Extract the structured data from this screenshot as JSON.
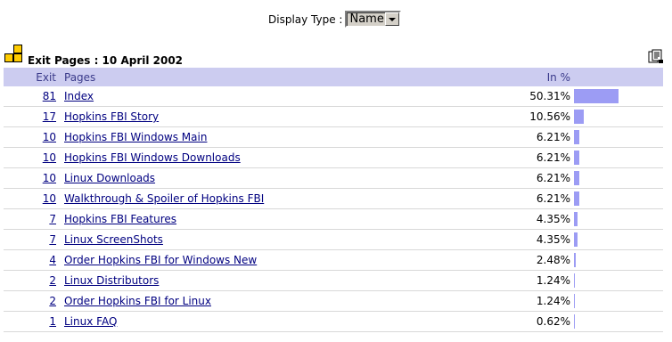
{
  "display_type": {
    "label": "Display Type :",
    "selected": "Name"
  },
  "section": {
    "title": "Exit Pages : 10 April 2002"
  },
  "table": {
    "headers": {
      "exit": "Exit",
      "pages": "Pages",
      "pct": "In %"
    },
    "rows": [
      {
        "exit": "81",
        "page": "Index",
        "pct": "50.31%",
        "share": 0.5031
      },
      {
        "exit": "17",
        "page": "Hopkins FBI Story",
        "pct": "10.56%",
        "share": 0.1056
      },
      {
        "exit": "10",
        "page": "Hopkins FBI Windows Main",
        "pct": "6.21%",
        "share": 0.0621
      },
      {
        "exit": "10",
        "page": "Hopkins FBI Windows Downloads",
        "pct": "6.21%",
        "share": 0.0621
      },
      {
        "exit": "10",
        "page": "Linux Downloads",
        "pct": "6.21%",
        "share": 0.0621
      },
      {
        "exit": "10",
        "page": "Walkthrough & Spoiler of Hopkins FBI",
        "pct": "6.21%",
        "share": 0.0621
      },
      {
        "exit": "7",
        "page": "Hopkins FBI Features",
        "pct": "4.35%",
        "share": 0.0435
      },
      {
        "exit": "7",
        "page": "Linux ScreenShots",
        "pct": "4.35%",
        "share": 0.0435
      },
      {
        "exit": "4",
        "page": "Order Hopkins FBI for Windows New",
        "pct": "2.48%",
        "share": 0.0248
      },
      {
        "exit": "2",
        "page": "Linux Distributors",
        "pct": "1.24%",
        "share": 0.0124
      },
      {
        "exit": "2",
        "page": "Order Hopkins FBI for Linux",
        "pct": "1.24%",
        "share": 0.0124
      },
      {
        "exit": "1",
        "page": "Linux FAQ",
        "pct": "0.62%",
        "share": 0.0062
      }
    ]
  },
  "colors": {
    "bar": "#9c9cf4",
    "header_bg": "#ccccf0",
    "link": "#000080",
    "section_icon": "#ffcc00"
  },
  "icons": {
    "section": "orange-squares-icon",
    "export": "export-icon"
  }
}
